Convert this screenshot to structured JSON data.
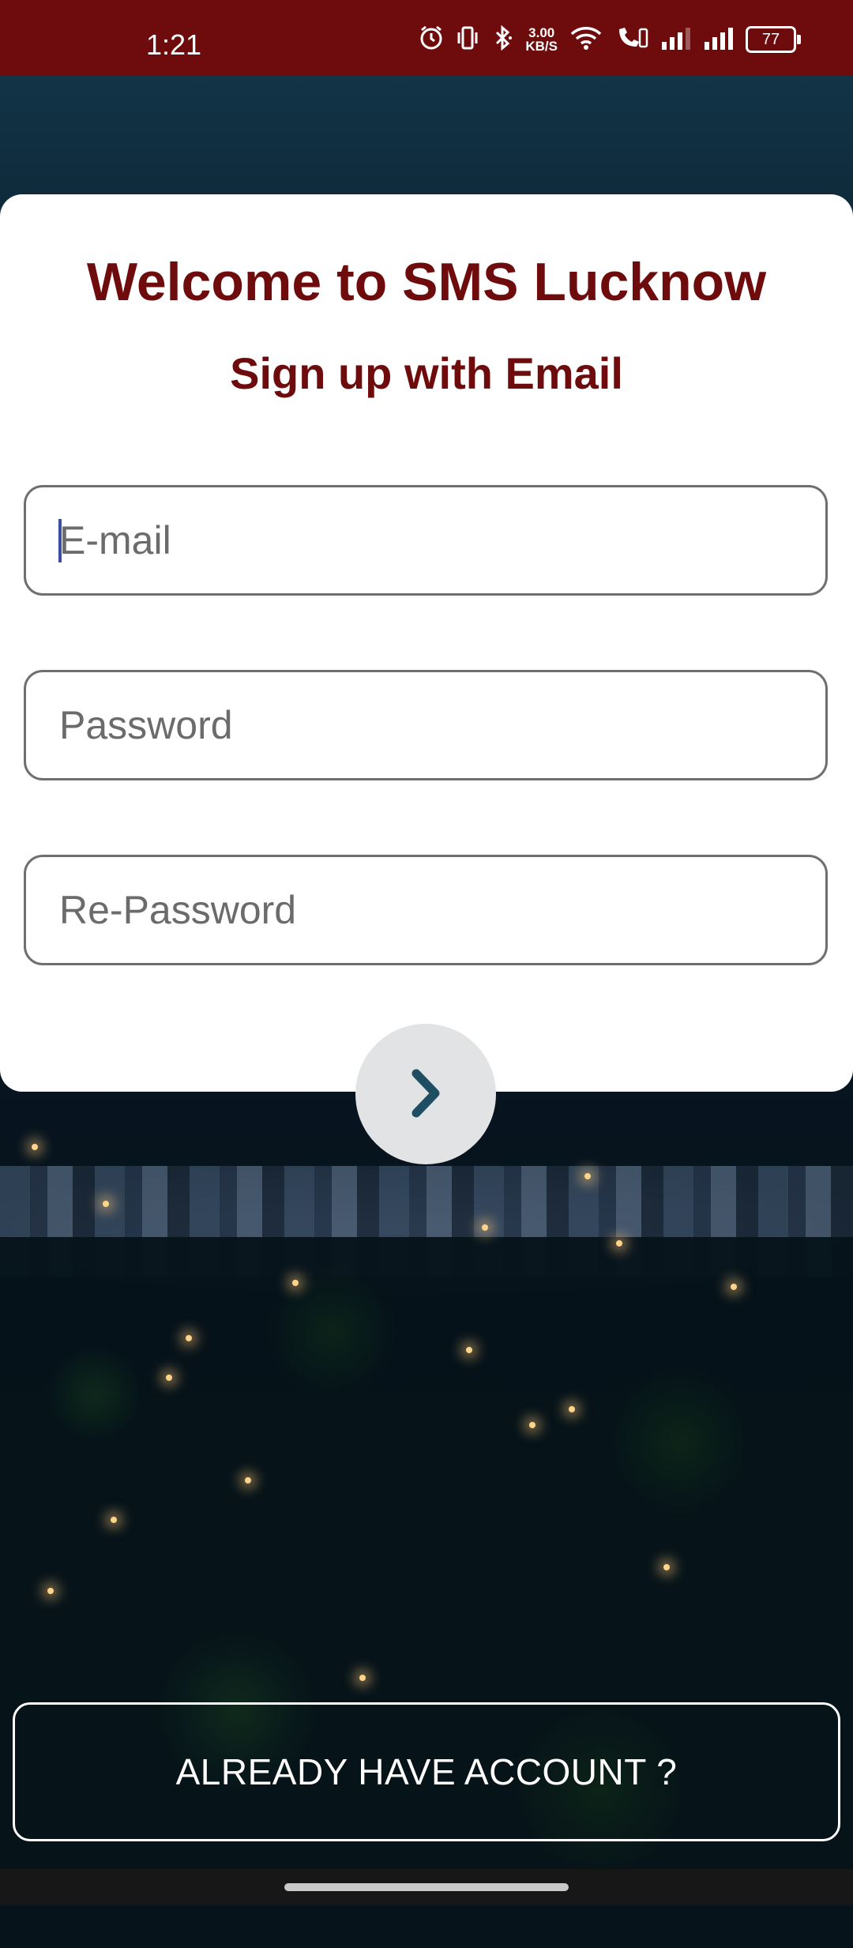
{
  "status_bar": {
    "time": "1:21",
    "net_speed_value": "3.00",
    "net_speed_unit": "KB/S",
    "battery_level": "77",
    "icons": [
      "alarm-icon",
      "vibrate-icon",
      "bluetooth-icon",
      "wifi-icon",
      "volte-call-icon",
      "signal-icon",
      "signal-icon",
      "battery-icon"
    ],
    "background_color": "#6e0b0c"
  },
  "header": {
    "title": "Welcome to SMS Lucknow",
    "subtitle": "Sign up with Email",
    "text_color": "#6e0b0c"
  },
  "form": {
    "email_placeholder": "E-mail",
    "email_value": "",
    "password_placeholder": "Password",
    "password_value": "",
    "repassword_placeholder": "Re-Password",
    "repassword_value": ""
  },
  "next_button": {
    "icon": "chevron-right-icon",
    "icon_color": "#1f4e63"
  },
  "footer": {
    "account_button_label": "ALREADY HAVE ACCOUNT ?"
  }
}
